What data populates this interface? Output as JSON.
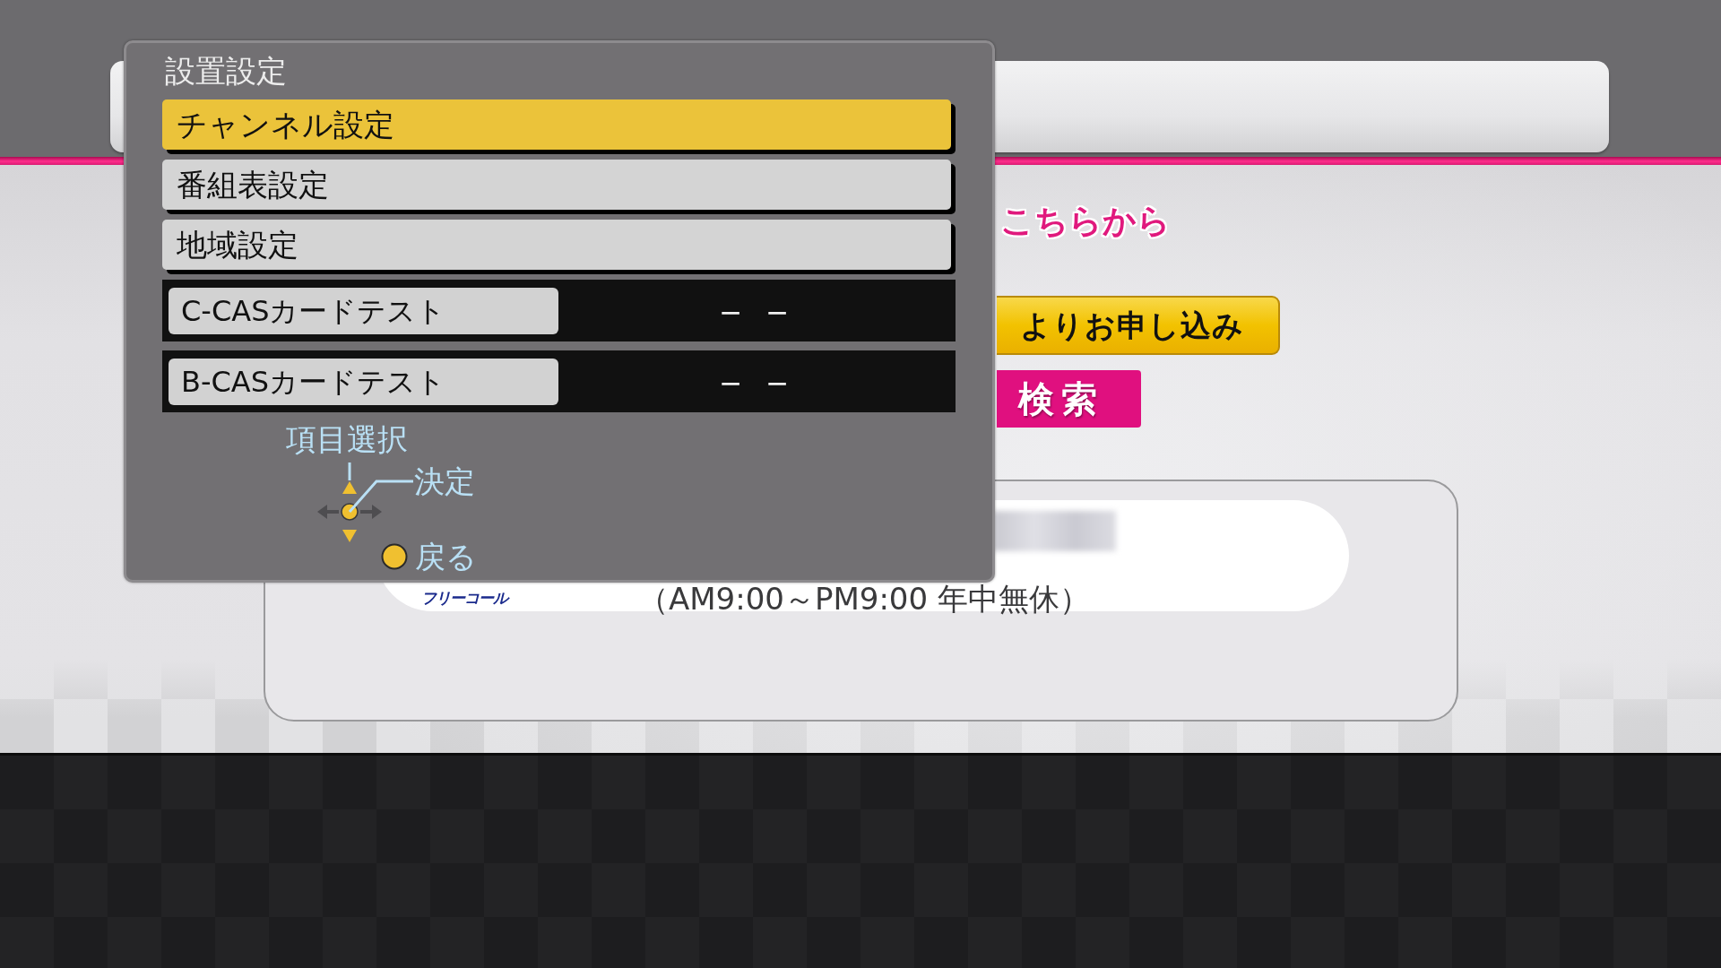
{
  "background": {
    "heading_fragment": "こちらから",
    "apply_button": "よりお申し込み",
    "search_button": "検索",
    "contact": {
      "label": "フリーコール",
      "hours": "（AM9:00～PM9:00 年中無休）"
    }
  },
  "dialog": {
    "title": "設置設定",
    "menu": [
      {
        "label": "チャンネル設定",
        "selected": true
      },
      {
        "label": "番組表設定",
        "selected": false
      },
      {
        "label": "地域設定",
        "selected": false
      }
    ],
    "tests": [
      {
        "label": "C-CASカードテスト",
        "value": "－－"
      },
      {
        "label": "B-CASカードテスト",
        "value": "－－"
      }
    ],
    "guide": {
      "select": "項目選択",
      "confirm": "決定",
      "back": "戻る"
    }
  }
}
